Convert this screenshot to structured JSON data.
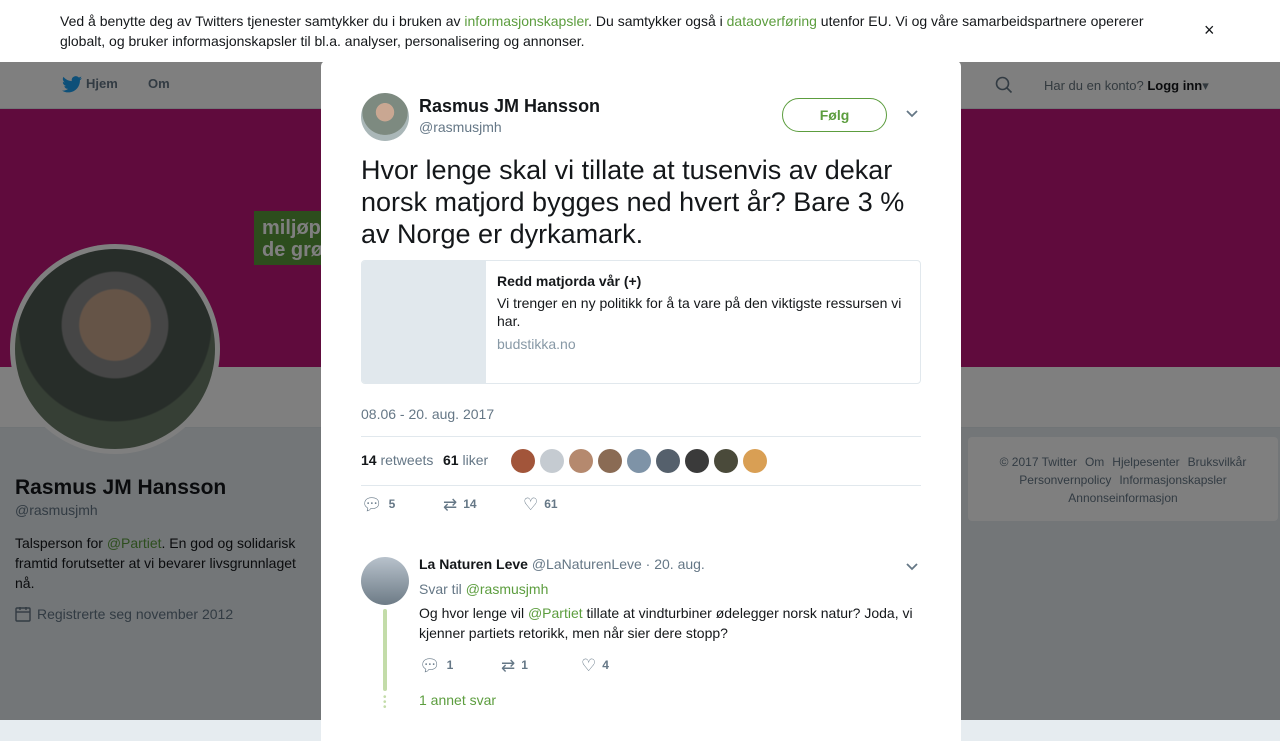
{
  "cookie": {
    "text_1": "Ved å benytte deg av Twitters tjenester samtykker du i bruken av ",
    "link_1": "informasjonskapsler",
    "text_2": ". Du samtykker også i ",
    "link_2": "dataoverføring",
    "text_3": " utenfor EU. Vi og våre samarbeidspartnere opererer globalt, og bruker informasjonskapsler til bl.a. analyser, personalisering og annonser.",
    "close": "×"
  },
  "overlay_close": "✕",
  "nav": {
    "home": "Hjem",
    "about": "Om",
    "have_account": "Har du en konto?",
    "login": "Logg inn",
    "login_caret": "▾"
  },
  "banner": {
    "logo_text": "miljøp de grø"
  },
  "profile": {
    "name": "Rasmus JM Hansson",
    "handle": "@rasmusjmh",
    "bio_1": "Talsperson for ",
    "bio_link": "@Partiet",
    "bio_2": ". En god og solidarisk framtid forutsetter at vi bevarer livsgrunnlaget nå.",
    "joined": "Registrerte seg november 2012"
  },
  "footer": {
    "items": [
      "© 2017 Twitter",
      "Om",
      "Hjelpesenter",
      "Bruksvilkår",
      "Personvernpolicy",
      "Informasjonskapsler",
      "Annonseinformasjon"
    ]
  },
  "tweet": {
    "name": "Rasmus JM Hansson",
    "handle": "@rasmusjmh",
    "follow": "Følg",
    "text": "Hvor lenge skal vi tillate at tusenvis av dekar norsk matjord bygges ned hvert år? Bare 3 % av Norge er dyrkamark.",
    "card": {
      "title": "Redd matjorda vår (+)",
      "description": "Vi trenger en ny politikk for å ta vare på den viktigste ressursen vi har.",
      "url": "budstikka.no"
    },
    "timestamp": "08.06 - 20. aug. 2017",
    "retweets": "14",
    "retweets_label": "retweets",
    "likes": "61",
    "likes_label": "liker",
    "liker_avatar_colors": [
      "#a2553a",
      "#c5cbd1",
      "#b5896e",
      "#8a6b54",
      "#7e93a7",
      "#55606c",
      "#3a3a3a",
      "#4a4a3a",
      "#d99f54"
    ],
    "actions": {
      "replies": "5",
      "retweets": "14",
      "likes": "61"
    }
  },
  "reply": {
    "name": "La Naturen Leve",
    "handle": "@LaNaturenLeve",
    "date": "· 20. aug.",
    "reply_to_label": "Svar til ",
    "reply_to": "@rasmusjmh",
    "text_1": "Og hvor lenge vil ",
    "text_link": "@Partiet",
    "text_2": " tillate at vindturbiner ødelegger norsk natur? Joda, vi kjenner partiets retorikk, men når sier dere stopp?",
    "actions": {
      "replies": "1",
      "retweets": "1",
      "likes": "4"
    },
    "more": "1 annet svar"
  },
  "icons": {
    "reply": "reply-icon",
    "retweet": "retweet-icon",
    "like": "heart-icon",
    "chevron": "chevron-down-icon",
    "calendar": "calendar-icon",
    "search": "search-icon",
    "twitter": "twitter-bird-icon"
  },
  "colors": {
    "accent": "#5c9d3e",
    "banner": "#c0167a",
    "text": "#14171a",
    "muted": "#657786"
  }
}
